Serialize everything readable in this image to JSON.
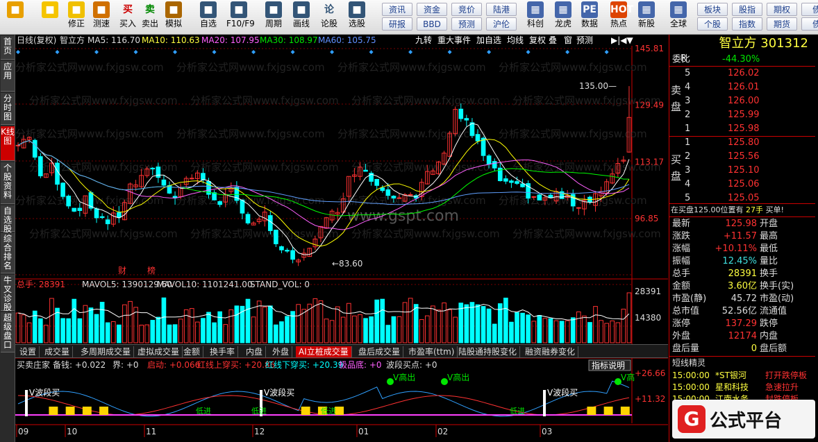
{
  "toolbar": {
    "items": [
      {
        "label": "",
        "icon": "windows-logo-icon"
      },
      {
        "label": "",
        "icon": "back-arrow-icon"
      },
      {
        "label": "修正",
        "icon": "up-down-arrow-icon"
      },
      {
        "label": "测速",
        "icon": "speed-icon"
      },
      {
        "label": "买入",
        "icon": "买"
      },
      {
        "label": "卖出",
        "icon": "卖"
      },
      {
        "label": "模拟",
        "icon": "hammer-icon"
      },
      {
        "label": "自选",
        "icon": "star-icon"
      },
      {
        "label": "F10/F9",
        "icon": "f10-icon"
      },
      {
        "label": "周期",
        "icon": "clock-icon"
      },
      {
        "label": "画线",
        "icon": "pen-icon"
      },
      {
        "label": "论股",
        "icon": "论"
      },
      {
        "label": "选股",
        "icon": "select-icon"
      }
    ],
    "btn_col1": [
      "资讯",
      "研报"
    ],
    "btn_col2": [
      "资金",
      "BBD"
    ],
    "btn_col3": [
      "竞价",
      "预测"
    ],
    "btn_col4": [
      "陆港",
      "沪伦"
    ],
    "items2": [
      {
        "label": "科创"
      },
      {
        "label": "龙虎"
      },
      {
        "label": "数据",
        "icon": "PE"
      },
      {
        "label": "热点",
        "icon": "HOT"
      },
      {
        "label": "新股"
      },
      {
        "label": "全球"
      }
    ],
    "btn_col5": [
      "板块",
      "个股"
    ],
    "btn_col6": [
      "股指",
      "指数"
    ],
    "btn_col7": [
      "期权",
      "期货"
    ],
    "btn_col8": [
      "债",
      "债"
    ]
  },
  "left_tabs": [
    "首页",
    "应用",
    "分时图",
    "K线图",
    "个股资料",
    "自选股",
    "综合排名",
    "牛叉诊股",
    "超级盘口"
  ],
  "chart_header": {
    "period": "日线(复权)",
    "name": "智立方",
    "ma5": "MA5: 116.70",
    "ma10": "MA10: 110.63",
    "ma20": "MA20: 107.95",
    "ma30": "MA30: 108.97",
    "ma60": "MA60: 105.75",
    "buttons": [
      "九转",
      "重大事件",
      "加自选",
      "均线",
      "复权",
      "叠",
      "窗",
      "预测"
    ]
  },
  "price_axis": [
    "145.81",
    "129.49",
    "113.17",
    "96.85"
  ],
  "annotations": {
    "high": "135.00",
    "low": "83.60",
    "cai": "财",
    "bang": "榜"
  },
  "watermark": "分析家公式网www.fxjgsw.com",
  "watermark2": "www.gspt.com",
  "vol_header": {
    "total": "总手: 28391",
    "mavol5": "MAVOL5: 1390129.60",
    "mavol10": "MAVOL10: 1101241.00",
    "stand": "STAND_VOL: 0"
  },
  "vol_axis": [
    "28391",
    "14380"
  ],
  "tabs": [
    "设置",
    "成交量",
    "多周期成交量",
    "虚拟成交量",
    "金额",
    "换手率",
    "内盘",
    "外盘",
    "AI立桩成交量",
    "盘后成交量",
    "市盈率(ttm)",
    "陆股通持股变化",
    "融资融券变化"
  ],
  "ind_header": {
    "name": "买卖庄家",
    "a": "备钱: +0.022",
    "b": "界: +0",
    "c": "启动: +0.066",
    "d": "红线上穿买: +20.86",
    "e": "红线下穿买: +20.39",
    "f": "极品底: +0",
    "g": "波段买点: +0",
    "help": "指标说明"
  },
  "ind_axis": [
    "26.66",
    "11.32"
  ],
  "ind_labels": {
    "v1": "V波段买",
    "v2": "V波段买",
    "v3": "V波段买",
    "g1": "V高出",
    "g2": "V高出",
    "g3": "V高",
    "bj": "低进"
  },
  "dates": [
    "09",
    "10",
    "11",
    "12",
    "01",
    "02",
    "03"
  ],
  "right": {
    "name": "智立方",
    "code": "301312",
    "r": "R",
    "weibi_label": "委比",
    "weibi": "-44.30%",
    "sell_label": [
      "卖",
      "盘"
    ],
    "buy_label": [
      "买",
      "盘"
    ],
    "sells": [
      {
        "n": "5",
        "p": "126.02"
      },
      {
        "n": "4",
        "p": "126.01"
      },
      {
        "n": "3",
        "p": "126.00"
      },
      {
        "n": "2",
        "p": "125.99"
      },
      {
        "n": "1",
        "p": "125.98"
      }
    ],
    "buys": [
      {
        "n": "1",
        "p": "125.80"
      },
      {
        "n": "2",
        "p": "125.56"
      },
      {
        "n": "3",
        "p": "125.10"
      },
      {
        "n": "4",
        "p": "125.06"
      },
      {
        "n": "5",
        "p": "125.05"
      }
    ],
    "notice": "在买盘125.00位置有",
    "notice_hands": "27手",
    "notice_tail": "买单!",
    "stats": [
      {
        "k1": "最新",
        "v1": "125.98",
        "k2": "开盘",
        "c": "red"
      },
      {
        "k1": "涨跌",
        "v1": "+11.57",
        "k2": "最高",
        "c": "red"
      },
      {
        "k1": "涨幅",
        "v1": "+10.11%",
        "k2": "最低",
        "c": "red"
      },
      {
        "k1": "振幅",
        "v1": "12.45%",
        "k2": "量比",
        "c": "cyn"
      },
      {
        "k1": "总手",
        "v1": "28391",
        "k2": "换手",
        "c": "yel"
      },
      {
        "k1": "金额",
        "v1": "3.60亿",
        "k2": "换手(实)",
        "c": "yel"
      },
      {
        "k1": "市盈(静)",
        "v1": "45.72",
        "k2": "市盈(动)",
        "c": "wht"
      },
      {
        "k1": "总市值",
        "v1": "52.56亿",
        "k2": "流通值",
        "c": "wht"
      },
      {
        "k1": "涨停",
        "v1": "137.29",
        "k2": "跌停",
        "c": "red"
      },
      {
        "k1": "外盘",
        "v1": "12174",
        "k2": "内盘",
        "c": "red"
      },
      {
        "k1": "盘后量",
        "v1": "0",
        "k2": "盘后额",
        "c": "yel"
      }
    ],
    "short_title": "短线精灵",
    "short_list": [
      {
        "t": "15:00:00",
        "n": "*ST银河",
        "e": "打开跌停板"
      },
      {
        "t": "15:00:00",
        "n": "星和科技",
        "e": "急速拉升"
      },
      {
        "t": "15:00:00",
        "n": "江南水务",
        "e": "封跌停板"
      }
    ],
    "logo": "公式平台"
  },
  "colors": {
    "up": "#ff3232",
    "down": "#00ffff",
    "ma5": "#ffffff",
    "ma10": "#ffff00",
    "ma20": "#ff60ff",
    "ma30": "#00ff00",
    "ma60": "#60a0ff"
  }
}
